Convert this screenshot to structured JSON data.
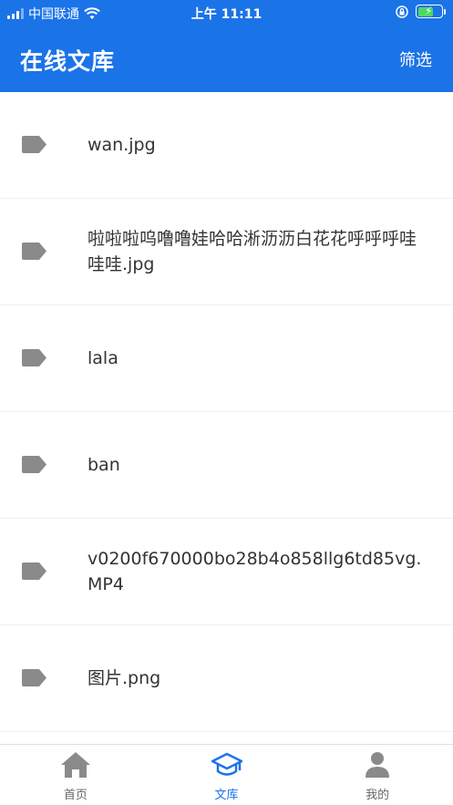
{
  "status_bar": {
    "carrier": "中国联通",
    "time": "上午 11:11"
  },
  "header": {
    "title": "在线文库",
    "filter_label": "筛选"
  },
  "files": [
    {
      "name": "wan.jpg"
    },
    {
      "name": "啦啦啦呜噜噜娃哈哈淅沥沥白花花呼呼呼哇哇哇.jpg"
    },
    {
      "name": "lala"
    },
    {
      "name": "ban"
    },
    {
      "name": "v0200f670000bo28b4o858llg6td85vg.MP4"
    },
    {
      "name": "图片.png"
    }
  ],
  "tabbar": {
    "tabs": [
      {
        "label": "首页",
        "icon": "home-icon"
      },
      {
        "label": "文库",
        "icon": "graduation-cap-icon"
      },
      {
        "label": "我的",
        "icon": "user-icon"
      }
    ],
    "active_index": 1
  },
  "colors": {
    "primary": "#1b73e8",
    "tag_icon": "#8a8a8a",
    "tab_inactive": "#8a8a8a"
  }
}
